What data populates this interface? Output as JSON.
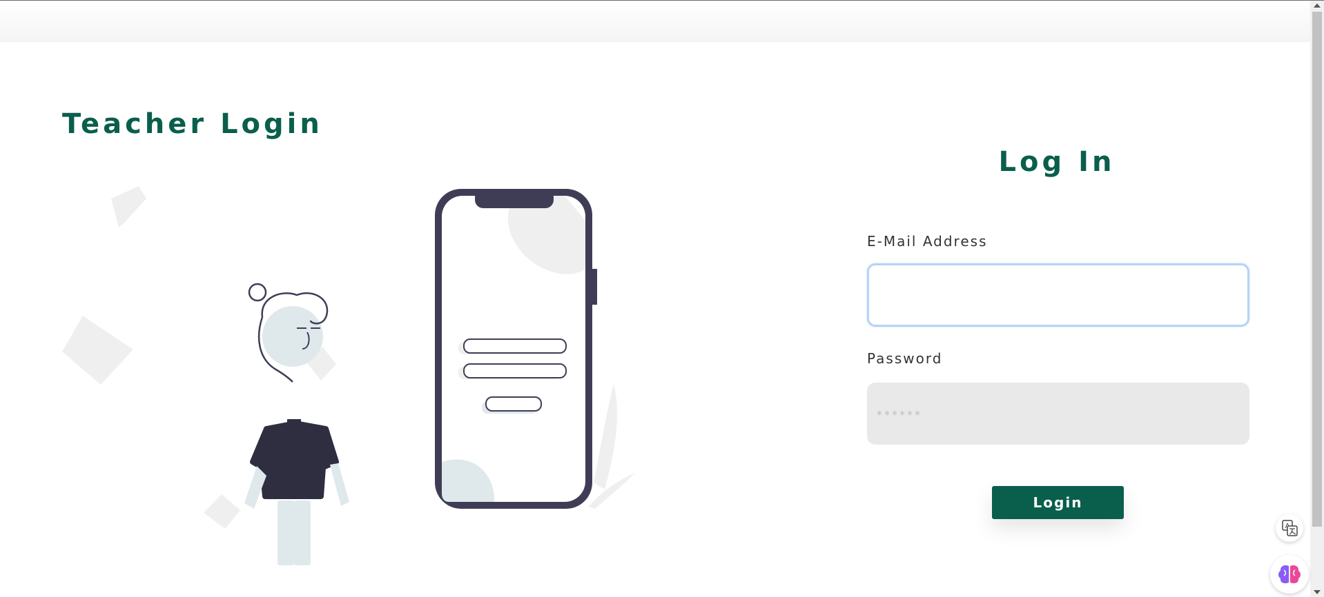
{
  "page": {
    "title": "Teacher Login"
  },
  "form": {
    "heading": "Log In",
    "email_label": "E-Mail Address",
    "email_value": "",
    "password_label": "Password",
    "password_placeholder": "******",
    "submit_label": "Login"
  },
  "colors": {
    "accent": "#0a5e4c",
    "input_focus_border": "#b7d3f6",
    "password_bg": "#e9e9e9",
    "illustration_dark": "#3f3d56",
    "illustration_light": "#dfe9ec",
    "illustration_shape": "#efefef"
  },
  "icons": {
    "translate": "translate-icon",
    "brain": "brain-icon"
  }
}
